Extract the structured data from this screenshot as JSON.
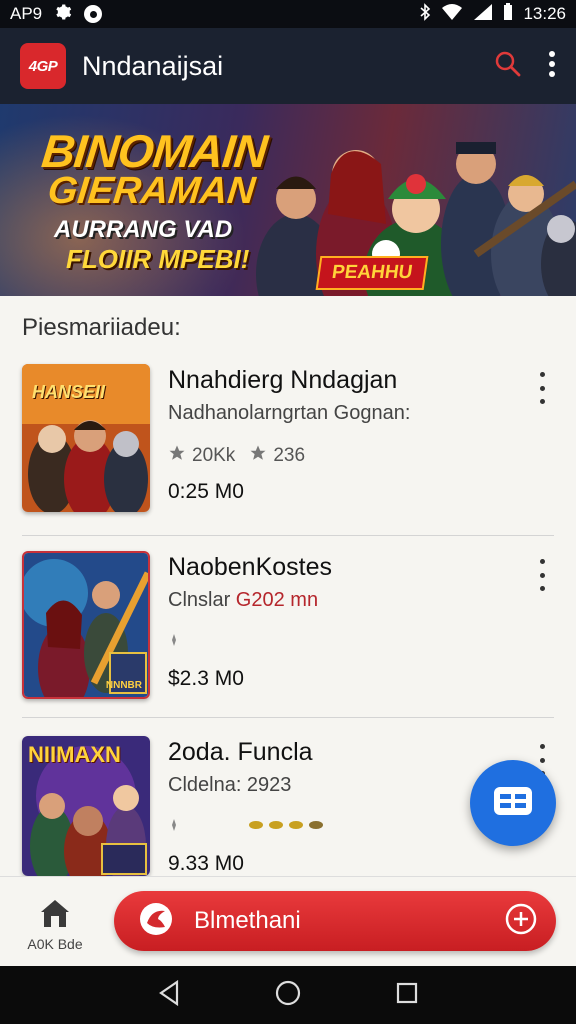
{
  "status_bar": {
    "left_text": "AP9",
    "time": "13:26"
  },
  "app_bar": {
    "logo_text": "4GP",
    "title": "Nndanaijsai"
  },
  "banner": {
    "line1": "BINOMAIN",
    "line2": "GIERAMAN",
    "line3": "AURRANG VAD",
    "line4": "FLOIIR MPEBI!",
    "badge": "PEAHHU"
  },
  "section": {
    "title": "Piesmariiadeu:"
  },
  "items": [
    {
      "thumb_text": "HANSEII",
      "name": "Nnahdierg Nndagjan",
      "sub": "Nadhanolarngrtan Gognan:",
      "rating_a": "20Kk",
      "rating_b": "236",
      "price": "0:25 M0"
    },
    {
      "thumb_text": "NNNBR",
      "name": "NaobenKostes",
      "sub_prefix": "Clnslar ",
      "sub_accent": "G202 mn",
      "price": "$2.3 M0"
    },
    {
      "thumb_text": "NIIMAXN",
      "name": "2oda. Funcla",
      "sub": "Cldelna: 2923",
      "price": "9.33 M0"
    }
  ],
  "bottom_nav": {
    "home_label": "A0K Bde",
    "cta_label": "Blmethani"
  },
  "colors": {
    "app_bar": "#1b2230",
    "accent_red": "#d9282c",
    "fab_blue": "#1f6fe0"
  }
}
